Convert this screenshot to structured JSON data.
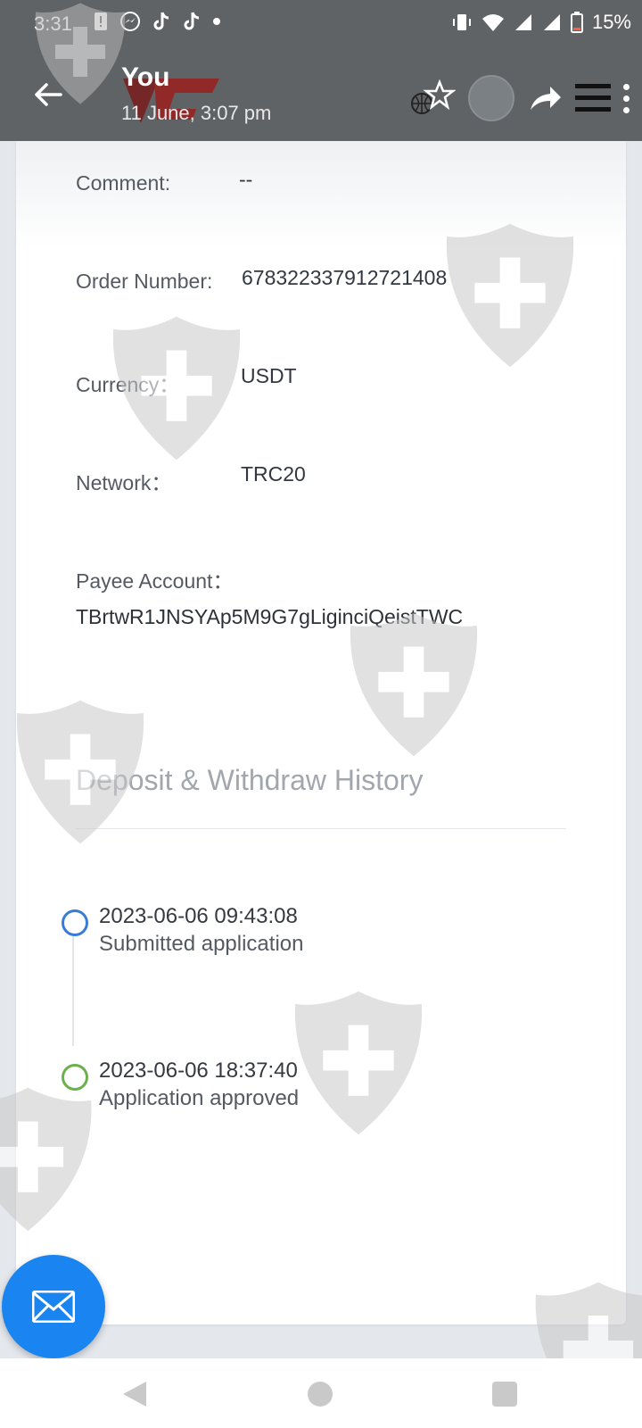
{
  "status_bar": {
    "time": "3:31",
    "battery": "15%"
  },
  "header": {
    "title": "You",
    "subtitle": "11 June, 3:07 pm"
  },
  "details": {
    "comment_label": "Comment:",
    "comment_value": "--",
    "order_label": "Order Number:",
    "order_value": "678322337912721408",
    "currency_label": "Currency：",
    "currency_value": "USDT",
    "network_label": "Network：",
    "network_value": "TRC20",
    "payee_label": "Payee Account：",
    "payee_value": "TBrtwR1JNSYAp5M9G7gLiginciQeistTWC"
  },
  "history": {
    "title": "Deposit & Withdraw History",
    "items": [
      {
        "time": "2023-06-06 09:43:08",
        "desc": "Submitted application",
        "color": "#3a7bd5"
      },
      {
        "time": "2023-06-06 18:37:40",
        "desc": "Application approved",
        "color": "#6ab04c"
      }
    ]
  },
  "colors": {
    "header_bg": "#5f6366",
    "fab": "#1a85f0",
    "watermark": "#c9c9c9"
  },
  "icons": [
    "back-arrow-icon",
    "globe-star-icon",
    "share-icon",
    "menu-icon",
    "more-vert-icon",
    "mail-icon",
    "shield-cross-watermark-icon"
  ]
}
